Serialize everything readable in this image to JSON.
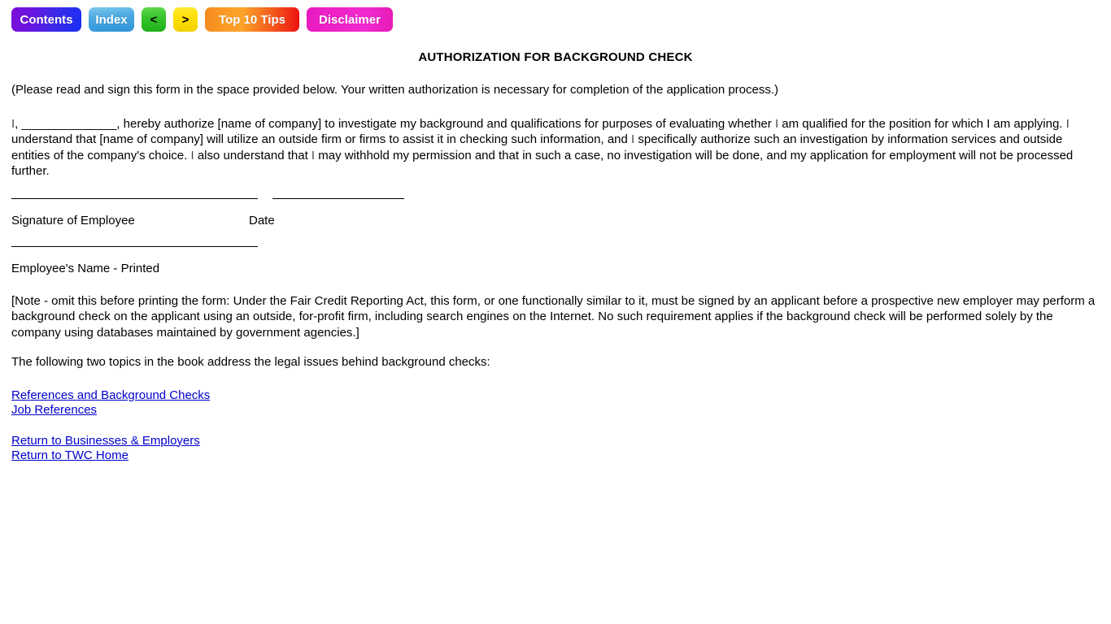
{
  "nav": {
    "buttons": [
      {
        "id": "contents",
        "label": "Contents"
      },
      {
        "id": "index",
        "label": "Index"
      },
      {
        "id": "prev",
        "label": "<"
      },
      {
        "id": "next",
        "label": ">"
      },
      {
        "id": "tips",
        "label": "Top 10 Tips"
      },
      {
        "id": "disclaimer",
        "label": "Disclaimer"
      }
    ]
  },
  "document": {
    "title": "AUTHORIZATION FOR BACKGROUND CHECK",
    "intro": "(Please read and sign this form in the space provided below. Your written authorization is necessary for completion of the application process.)",
    "authorization": {
      "part1_i": "I",
      "part2": ", ______________, hereby authorize [name of company] to investigate my background and qualifications for purposes of evaluating whether ",
      "part3_i": "I",
      "part4": " am qualified for the position for which I am applying. ",
      "part5_i": "I",
      "part6": " understand that [name of company] will utilize an outside firm or firms to assist it in checking such information, and ",
      "part7_i": "I",
      "part8": " specifically authorize such an investigation by information services and outside entities of the company's choice. ",
      "part9_i": "I",
      "part10": " also understand that ",
      "part11_i": "I",
      "part12": " may withhold my permission and that in such a case, no investigation will be done, and my application for employment will not be processed further."
    },
    "signature_label": "Signature of Employee",
    "date_label": "Date",
    "printed_name_label": "Employee's Name - Printed",
    "note": "[Note - omit this before printing the form: Under the Fair Credit Reporting Act, this form, or one functionally similar to it, must be signed by an applicant before a prospective new employer may perform a background check on the applicant using an outside, for-profit firm, including search engines on the Internet. No such requirement applies if the background check will be performed solely by the company using databases maintained by government agencies.]",
    "topics_intro": "The following two topics in the book address the legal issues behind background checks:"
  },
  "links": {
    "topics": [
      {
        "id": "references-and-background-checks",
        "label": "References and Background Checks"
      },
      {
        "id": "job-references",
        "label": "Job References"
      }
    ],
    "returns": [
      {
        "id": "return-to-businesses-employers",
        "label": "Return to Businesses & Employers"
      },
      {
        "id": "return-to-twc-home",
        "label": "Return to TWC Home"
      }
    ]
  },
  "colors": {
    "link": "#0000cc",
    "text": "#000000",
    "highlight": "#4a4a52",
    "background": "#ffffff"
  }
}
